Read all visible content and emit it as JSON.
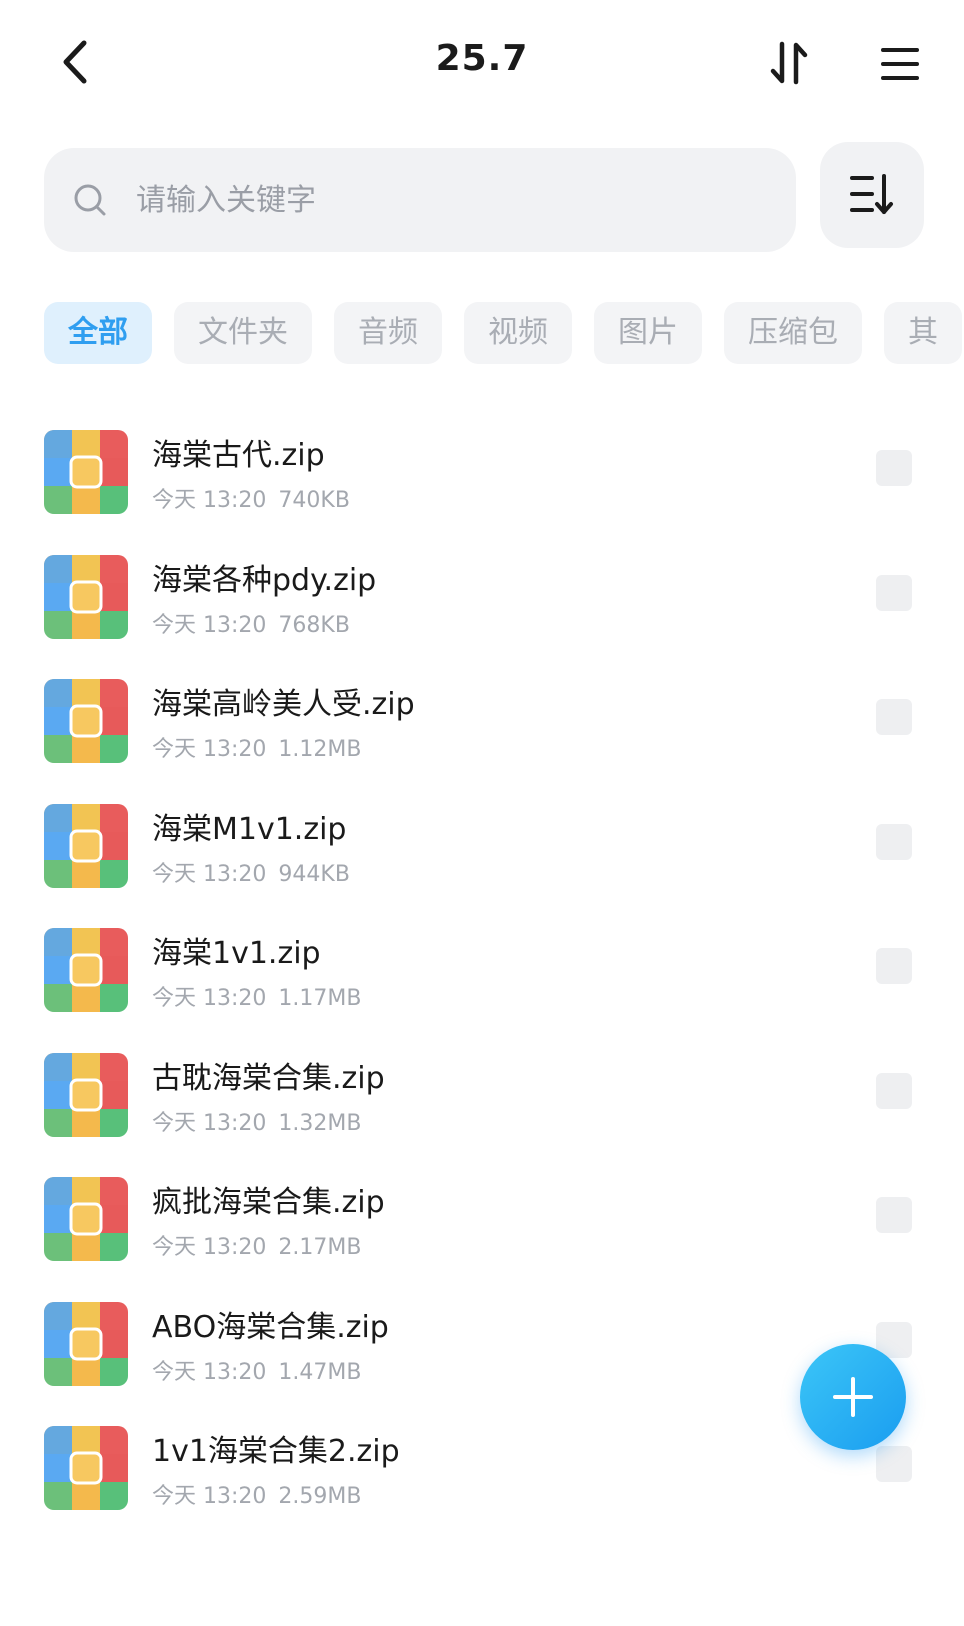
{
  "header": {
    "title": "25.7"
  },
  "search": {
    "placeholder": "请输入关键字"
  },
  "tabs": [
    {
      "label": "全部",
      "active": true
    },
    {
      "label": "文件夹",
      "active": false
    },
    {
      "label": "音频",
      "active": false
    },
    {
      "label": "视频",
      "active": false
    },
    {
      "label": "图片",
      "active": false
    },
    {
      "label": "压缩包",
      "active": false
    },
    {
      "label": "其",
      "active": false
    }
  ],
  "files": [
    {
      "name": "海棠古代.zip",
      "date": "今天 13:20",
      "size": "740KB"
    },
    {
      "name": "海棠各种pdy.zip",
      "date": "今天 13:20",
      "size": "768KB"
    },
    {
      "name": "海棠高岭美人受.zip",
      "date": "今天 13:20",
      "size": "1.12MB"
    },
    {
      "name": "海棠M1v1.zip",
      "date": "今天 13:20",
      "size": "944KB"
    },
    {
      "name": "海棠1v1.zip",
      "date": "今天 13:20",
      "size": "1.17MB"
    },
    {
      "name": "古耽海棠合集.zip",
      "date": "今天 13:20",
      "size": "1.32MB"
    },
    {
      "name": "疯批海棠合集.zip",
      "date": "今天 13:20",
      "size": "2.17MB"
    },
    {
      "name": "ABO海棠合集.zip",
      "date": "今天 13:20",
      "size": "1.47MB"
    },
    {
      "name": "1v1海棠合集2.zip",
      "date": "今天 13:20",
      "size": "2.59MB"
    }
  ],
  "colors": {
    "accent": "#1a9df0",
    "tab_active_bg": "#dff0fd",
    "tab_active_text": "#2f9ef0"
  }
}
